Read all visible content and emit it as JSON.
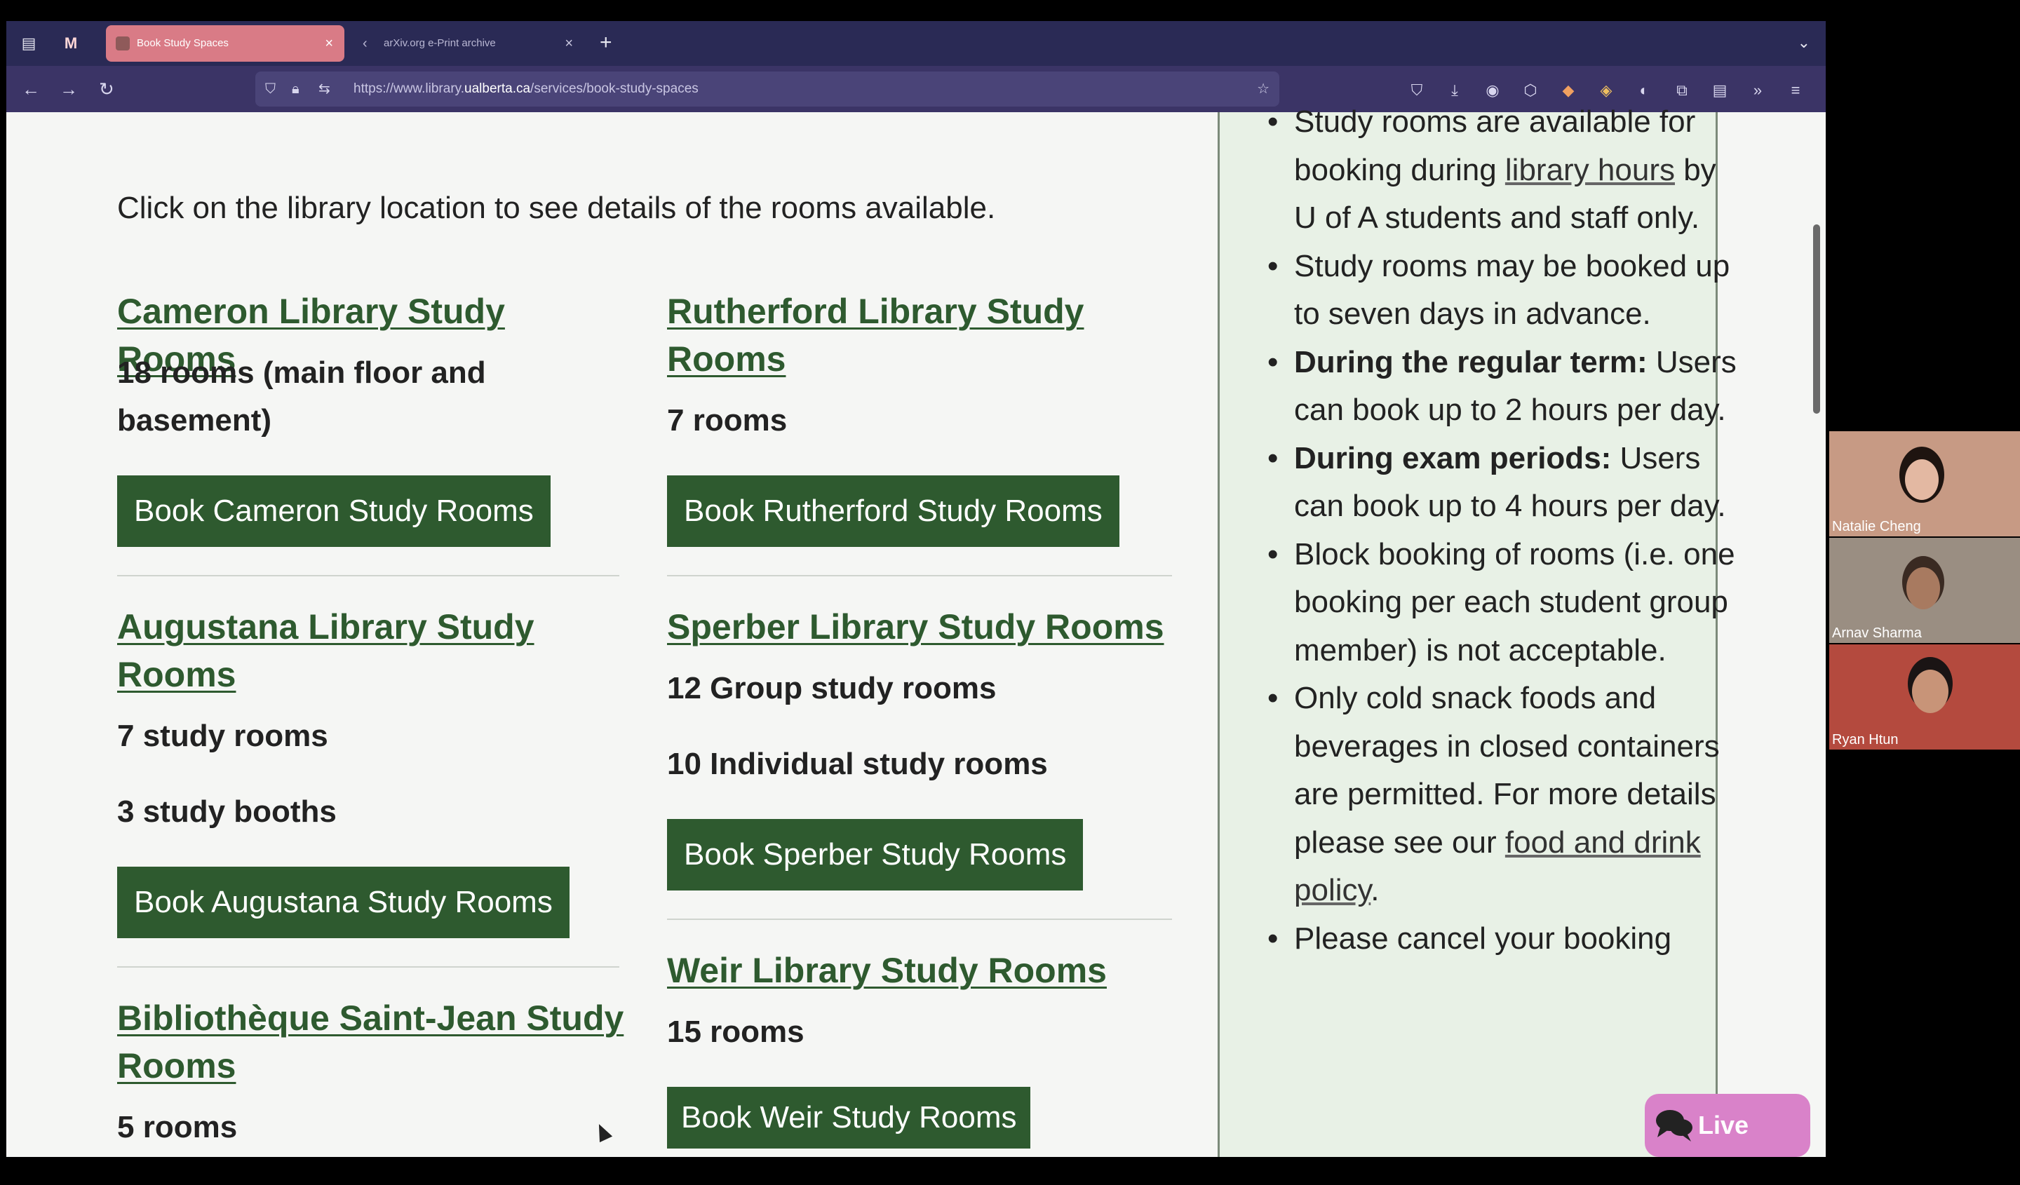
{
  "browser": {
    "tabs": [
      {
        "title": "Book Study Spaces",
        "active": true
      },
      {
        "title": "arXiv.org e-Print archive",
        "active": false
      }
    ],
    "url_prefix": "https://www.library.",
    "url_domain": "ualberta.ca",
    "url_path": "/services/book-study-spaces"
  },
  "page": {
    "intro": "Click on the library location to see details of the rooms available.",
    "libraries": [
      {
        "title": "Cameron Library Study Rooms",
        "info": [
          "18 rooms (main floor and basement)"
        ],
        "button": "Book Cameron Study Rooms"
      },
      {
        "title": "Rutherford Library Study Rooms",
        "info": [
          "7 rooms"
        ],
        "button": "Book Rutherford Study Rooms"
      },
      {
        "title": "Augustana Library Study Rooms",
        "info": [
          "7 study rooms",
          "3 study booths"
        ],
        "button": "Book Augustana Study Rooms"
      },
      {
        "title": "Sperber Library Study Rooms",
        "info": [
          "12 Group study rooms",
          "10 Individual study rooms"
        ],
        "button": "Book Sperber Study Rooms"
      },
      {
        "title": "Bibliothèque Saint-Jean Study Rooms",
        "info": [
          "5 rooms"
        ]
      },
      {
        "title": "Weir Library Study Rooms",
        "info": [
          "15 rooms"
        ],
        "button": "Book Weir Study Rooms"
      }
    ],
    "rules": {
      "r1_a": "Study rooms are available for booking during ",
      "r1_link": "library hours",
      "r1_b": " by U of A students and staff only.",
      "r2": "Study rooms may be booked up to seven days in advance.",
      "r3_bold": "During the regular term:",
      "r3_text": " Users can book up to 2 hours per day.",
      "r4_bold": "During exam periods:",
      "r4_text": " Users can book up to 4 hours per day.",
      "r5": "Block booking of rooms (i.e. one booking per each student group member) is not acceptable.",
      "r6_a": "Only cold snack foods and beverages in closed containers are permitted. For more details please see our ",
      "r6_link": "food and drink policy",
      "r6_b": ".",
      "r7": "Please cancel your booking"
    },
    "live_chat": "Live Chat"
  },
  "participants": [
    {
      "name": "Natalie Cheng"
    },
    {
      "name": "Arnav Sharma"
    },
    {
      "name": "Ryan Htun"
    }
  ],
  "colors": {
    "brand_green": "#2e5a2f",
    "tab_active": "#d97b86",
    "live_chat": "#d982c9"
  }
}
